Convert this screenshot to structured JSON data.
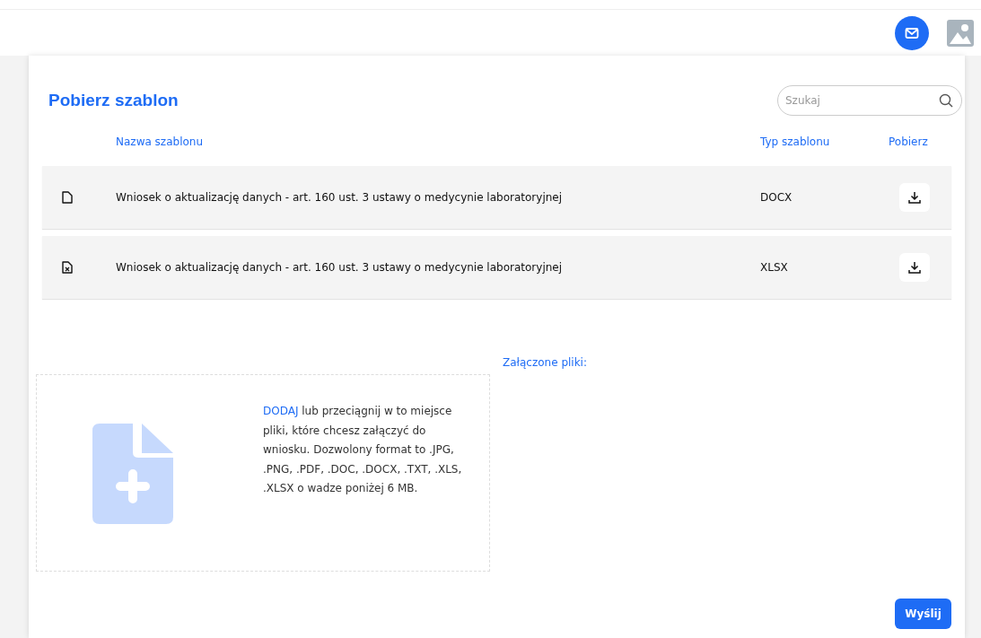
{
  "page_title": "Pobierz szablon",
  "search": {
    "placeholder": "Szukaj"
  },
  "table": {
    "columns": [
      "Nazwa szablonu",
      "Typ szablonu",
      "Pobierz"
    ],
    "rows": [
      {
        "kind": "document",
        "name": "Wniosek o aktualizację danych - art. 160 ust. 3 ustawy o medycynie laboratoryjnej",
        "type": "DOCX"
      },
      {
        "kind": "spreadsheet",
        "name": "Wniosek o aktualizację danych - art. 160 ust. 3 ustawy o medycynie laboratoryjnej",
        "type": "XLSX"
      }
    ]
  },
  "upload": {
    "link": "DODAJ",
    "text": "lub przeciągnij w to miejsce pliki, które chcesz załączyć do wniosku. Dozwolony format to .JPG, .PNG, .PDF, .DOC, .DOCX, .TXT, .XLS, .XLSX o wadze poniżej 6 MB."
  },
  "attached_label": "Załączone pliki:",
  "submit": "Wyślij"
}
